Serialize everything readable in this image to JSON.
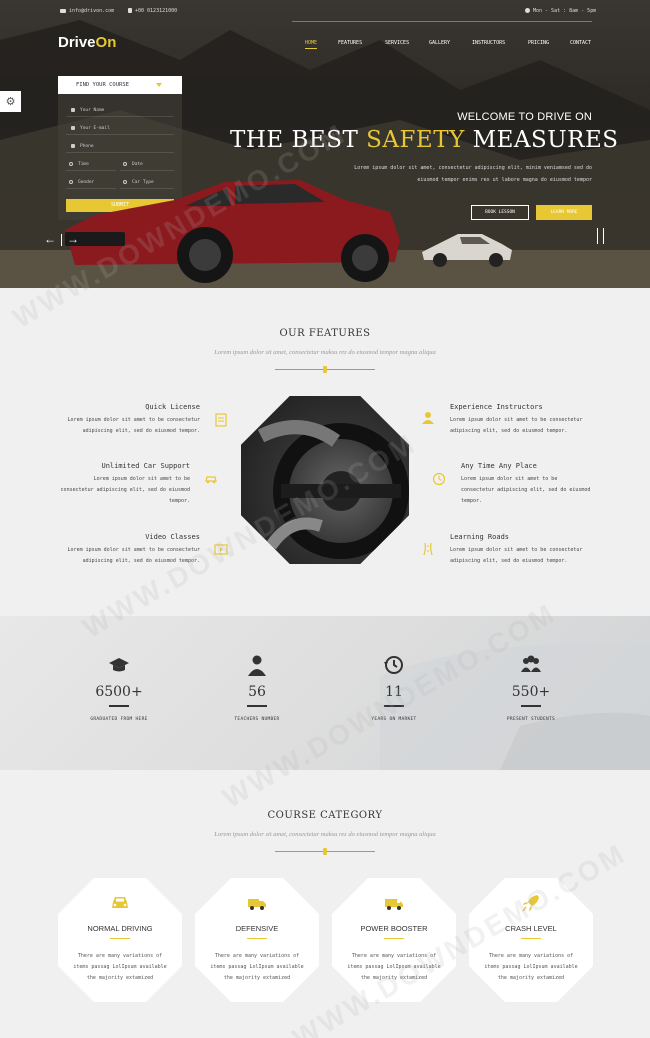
{
  "topbar": {
    "email": "info@drivon.com",
    "phone": "+00 0123121000",
    "hours": "Mon - Sat : 8am - 5pm"
  },
  "logo": {
    "text_a": "Drive",
    "text_b": "On"
  },
  "nav": {
    "items": [
      "HOME",
      "FEATURES",
      "SERVICES",
      "GALLERY",
      "INSTRUCTORS",
      "PRICING",
      "CONTACT"
    ],
    "active": "HOME"
  },
  "course_form": {
    "title": "FIND YOUR COURSE",
    "fields": {
      "name": "Your Name",
      "email": "Your E-mail",
      "phone": "Phone",
      "time": "Time",
      "date": "Date",
      "gender": "Gender",
      "car_type": "Car Type"
    },
    "submit": "SUBMIT"
  },
  "hero": {
    "welcome": "WELCOME TO DRIVE ON",
    "headline_a": "THE BEST",
    "headline_b": "SAFETY",
    "headline_c": "MEASURES",
    "desc_1": "Lorem ipsum dolor sit amet, consectetur adipiscing elit, minim veniamsed sed do",
    "desc_2": "eiusmod tempor enims rex ut labore magna do eiusmod tempor",
    "btn_book": "BOOK LESSON",
    "btn_learn": "LEARN MORE"
  },
  "features": {
    "title": "OUR FEATURES",
    "subtitle": "Lorem ipsum dolor sit amet, consectetur maksu rez do eiusmod tempor magna aliqua",
    "items": [
      {
        "title": "Quick License",
        "desc_1": "Lorem ipsum dolor sit amet to be consectetur",
        "desc_2": "adipiscing elit, sed do eiusmod tempor."
      },
      {
        "title": "Unlimited Car Support",
        "desc_1": "Lorem ipsum dolor sit amet to be",
        "desc_2": "consectetur adipiscing elit, sed do eiusmod",
        "desc_3": "tempor."
      },
      {
        "title": "Video Classes",
        "desc_1": "Lorem ipsum dolor sit amet to be consectetur",
        "desc_2": "adipiscing elit, sed do eiusmod tempor."
      },
      {
        "title": "Experience Instructors",
        "desc_1": "Lorem ipsum dolor sit amet to be consectetur",
        "desc_2": "adipiscing elit, sed do eiusmod tempor."
      },
      {
        "title": "Any Time Any Place",
        "desc_1": "Lorem ipsum dolor sit amet to be",
        "desc_2": "consectetur adipiscing elit, sed do eiusmod",
        "desc_3": "tempor."
      },
      {
        "title": "Learning Roads",
        "desc_1": "Lorem ipsum dolor sit amet to be consectetur",
        "desc_2": "adipiscing elit, sed do eiusmod tempor."
      }
    ]
  },
  "stats": [
    {
      "value": "6500+",
      "label": "GRADUATED FROM HERE",
      "icon": "graduation-cap-icon"
    },
    {
      "value": "56",
      "label": "TEACHERS NUMBER",
      "icon": "teacher-icon"
    },
    {
      "value": "11",
      "label": "YEARS ON MARKET",
      "icon": "history-clock-icon"
    },
    {
      "value": "550+",
      "label": "PRESENT STUDENTS",
      "icon": "students-group-icon"
    }
  ],
  "courses": {
    "title": "COURSE CATEGORY",
    "subtitle": "Lorem ipsum dolor sit amet, consectetur maksu rez do eiusmod tempor magna aliqua",
    "items": [
      {
        "title": "NORMAL DRIVING",
        "desc_1": "There are many variations of",
        "desc_2": "items passag LolIpsum available",
        "desc_3": "the majority extamized"
      },
      {
        "title": "DEFENSIVE",
        "desc_1": "There are many variations of",
        "desc_2": "items passag LolIpsum available",
        "desc_3": "the majority extamized"
      },
      {
        "title": "POWER BOOSTER",
        "desc_1": "There are many variations of",
        "desc_2": "items passag LolIpsum available",
        "desc_3": "the majority extamized"
      },
      {
        "title": "CRASH LEVEL",
        "desc_1": "There are many variations of",
        "desc_2": "items passag LolIpsum available",
        "desc_3": "the majority extamized"
      }
    ]
  },
  "watermark": "WWW.DOWNDEMO.COM",
  "colors": {
    "accent": "#e8c734",
    "dark": "#333333",
    "band": "#e0e0e0"
  }
}
